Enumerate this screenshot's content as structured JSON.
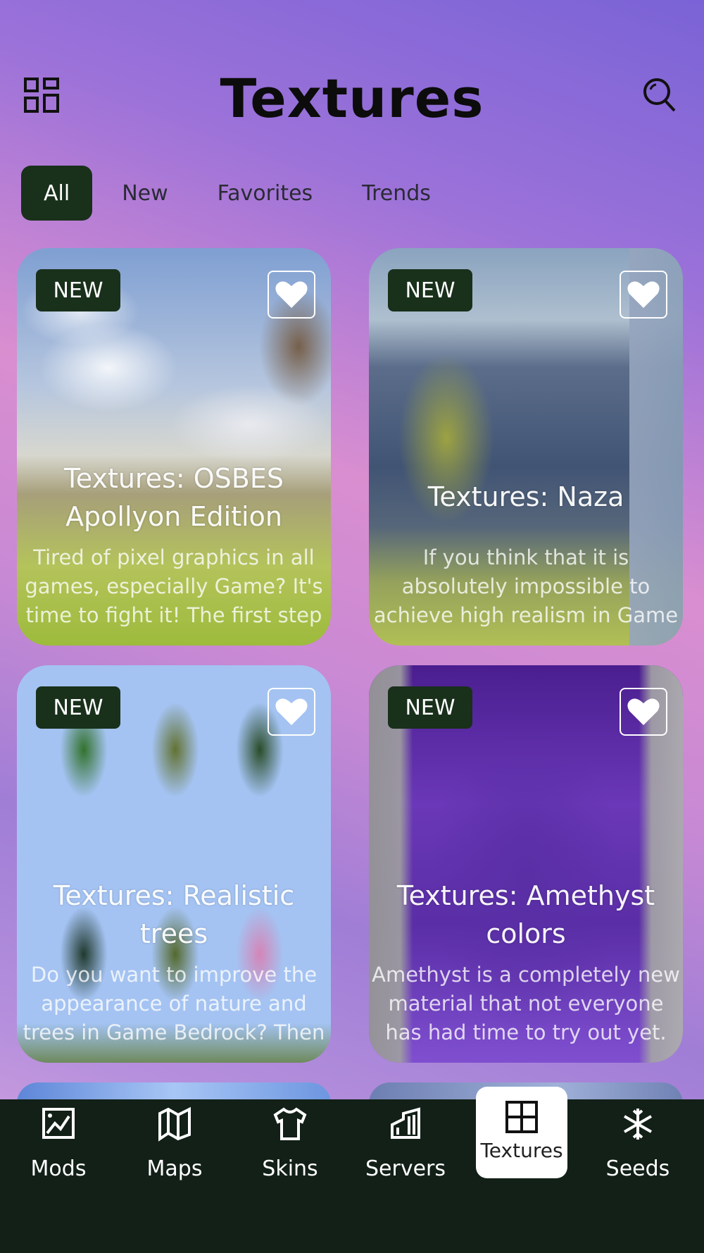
{
  "header": {
    "title": "Textures",
    "left_icon": "grid-view-icon",
    "right_icon": "search-icon"
  },
  "filters": [
    {
      "label": "All",
      "active": true
    },
    {
      "label": "New",
      "active": false
    },
    {
      "label": "Favorites",
      "active": false
    },
    {
      "label": "Trends",
      "active": false
    }
  ],
  "cards": [
    {
      "badge": "NEW",
      "title": "Textures: OSBES Apollyon Edition",
      "description": "Tired of pixel graphics in all games, especially Game? It's time to fight it! The first step is"
    },
    {
      "badge": "NEW",
      "title": "Textures: Naza",
      "description": "If you think that it is absolutely impossible to achieve high realism in Game Bedrock, then"
    },
    {
      "badge": "NEW",
      "title": "Textures: Realistic trees",
      "description": "Do you want to improve the appearance of nature and trees in Game Bedrock? Then"
    },
    {
      "badge": "NEW",
      "title": "Textures: Amethyst colors",
      "description": "Amethyst is a completely new material that not everyone has had time to try out yet."
    }
  ],
  "bottom_nav": [
    {
      "label": "Mods",
      "icon": "image-icon",
      "active": false
    },
    {
      "label": "Maps",
      "icon": "map-icon",
      "active": false
    },
    {
      "label": "Skins",
      "icon": "shirt-icon",
      "active": false
    },
    {
      "label": "Servers",
      "icon": "server-icon",
      "active": false
    },
    {
      "label": "Textures",
      "icon": "grid-icon",
      "active": true
    },
    {
      "label": "Seeds",
      "icon": "snowflake-icon",
      "active": false
    }
  ],
  "colors": {
    "accent_dark": "#19301b",
    "nav_bg": "#122017"
  }
}
